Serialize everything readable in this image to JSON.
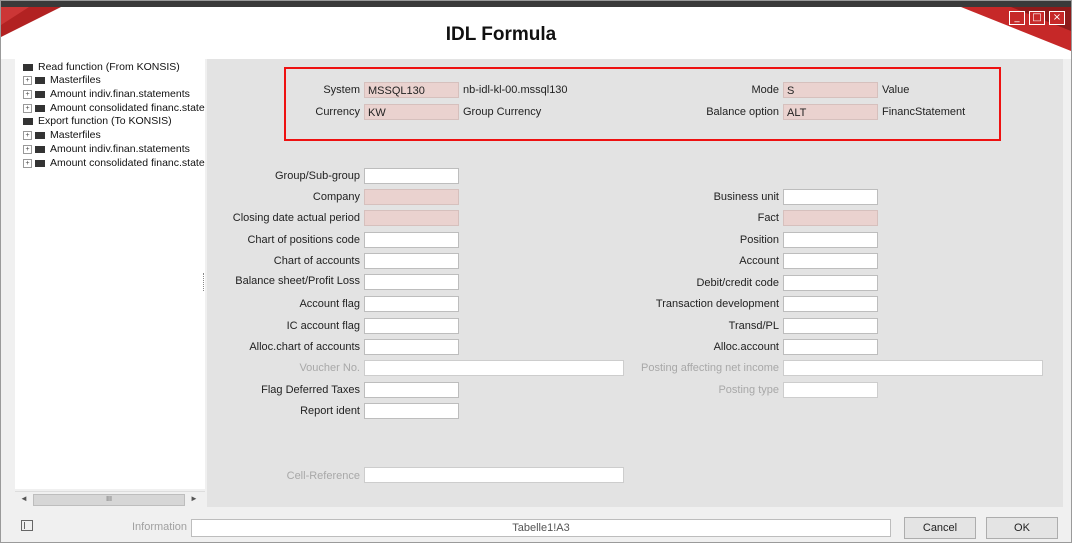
{
  "window": {
    "title": "IDL Formula",
    "controls": [
      "_",
      "□",
      "×"
    ]
  },
  "tree": {
    "items": [
      {
        "label": "Read function (From KONSIS)",
        "level": 0,
        "expandable": false
      },
      {
        "label": "Masterfiles",
        "level": 1,
        "expandable": true
      },
      {
        "label": "Amount indiv.finan.statements",
        "level": 1,
        "expandable": true
      },
      {
        "label": "Amount consolidated financ.state",
        "level": 1,
        "expandable": true
      },
      {
        "label": "Export function (To KONSIS)",
        "level": 0,
        "expandable": false
      },
      {
        "label": "Masterfiles",
        "level": 1,
        "expandable": true
      },
      {
        "label": "Amount indiv.finan.statements",
        "level": 1,
        "expandable": true
      },
      {
        "label": "Amount consolidated financ.state",
        "level": 1,
        "expandable": true
      }
    ],
    "scrollbar": {
      "left_arrow": "◄",
      "thumb_grip": "III",
      "right_arrow": "►"
    }
  },
  "header": {
    "system_label": "System",
    "system_value": "MSSQL130",
    "system_host": "nb-idl-kl-00.mssql130",
    "currency_label": "Currency",
    "currency_value": "KW",
    "currency_desc": "Group Currency",
    "mode_label": "Mode",
    "mode_value": "S",
    "mode_desc": "Value",
    "balance_label": "Balance option",
    "balance_value": "ALT",
    "balance_desc": "FinancStatement"
  },
  "form": {
    "left": [
      {
        "label": "Group/Sub-group",
        "value": "",
        "style": "normal"
      },
      {
        "label": "Company",
        "value": "",
        "style": "pink"
      },
      {
        "label": "Closing date actual period",
        "value": "",
        "style": "pink"
      },
      {
        "label": "Chart of positions code",
        "value": "",
        "style": "normal"
      },
      {
        "label": "Chart of accounts",
        "value": "",
        "style": "normal"
      },
      {
        "label": "Balance sheet/Profit  Loss",
        "value": "",
        "style": "normal"
      },
      {
        "label": "Account flag",
        "value": "",
        "style": "normal"
      },
      {
        "label": "IC account flag",
        "value": "",
        "style": "normal"
      },
      {
        "label": "Alloc.chart of accounts",
        "value": "",
        "style": "normal"
      },
      {
        "label": "Voucher No.",
        "value": "",
        "style": "disabled"
      },
      {
        "label": "Flag Deferred Taxes",
        "value": "",
        "style": "normal"
      },
      {
        "label": "Report ident",
        "value": "",
        "style": "normal"
      }
    ],
    "right": [
      {
        "label": "Business unit",
        "value": "",
        "style": "normal"
      },
      {
        "label": "Fact",
        "value": "",
        "style": "pink"
      },
      {
        "label": "Position",
        "value": "",
        "style": "normal"
      },
      {
        "label": "Account",
        "value": "",
        "style": "normal"
      },
      {
        "label": "Debit/credit code",
        "value": "",
        "style": "normal"
      },
      {
        "label": "Transaction development",
        "value": "",
        "style": "normal"
      },
      {
        "label": "Transd/PL",
        "value": "",
        "style": "normal"
      },
      {
        "label": "Alloc.account",
        "value": "",
        "style": "normal"
      },
      {
        "label": "Posting affecting net income",
        "value": "",
        "style": "disabled"
      },
      {
        "label": "Posting type",
        "value": "",
        "style": "disabled"
      }
    ],
    "cell_reference_label": "Cell-Reference",
    "cell_reference_value": ""
  },
  "footer": {
    "information_label": "Information",
    "information_value": "Tabelle1!A3",
    "cancel_label": "Cancel",
    "ok_label": "OK"
  },
  "colors": {
    "highlight_border": "#ee1111",
    "readonly_field": "#ead2cf",
    "brand_red": "#c62828"
  }
}
